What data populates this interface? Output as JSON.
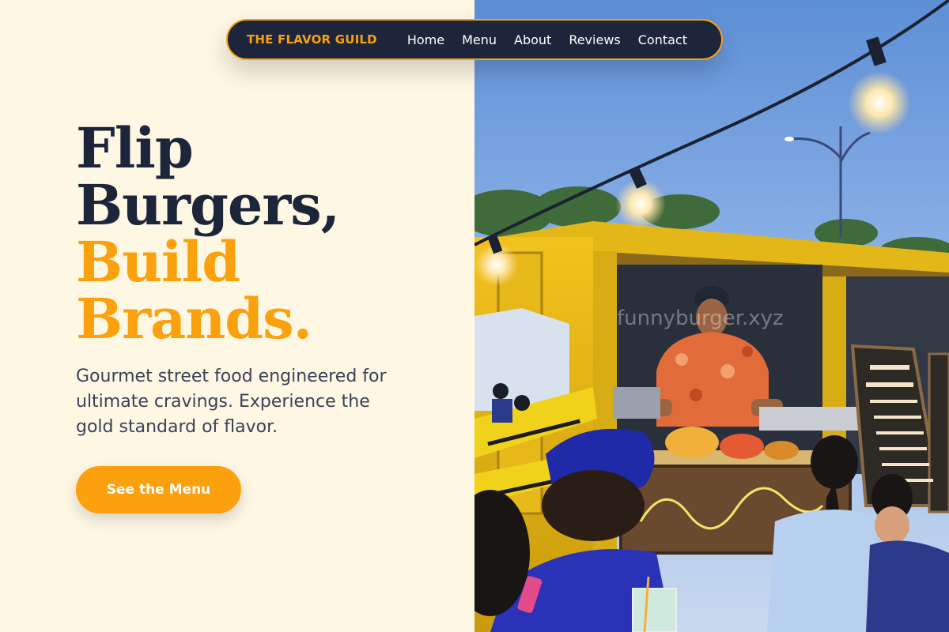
{
  "nav": {
    "brand": "THE FLAVOR GUILD",
    "links": [
      "Home",
      "Menu",
      "About",
      "Reviews",
      "Contact"
    ]
  },
  "hero": {
    "headline_dark": [
      "Flip",
      "Burgers,"
    ],
    "headline_accent": [
      "Build",
      "Brands."
    ],
    "subtext": "Gourmet street food engineered for ultimate cravings. Experience the gold standard of flavor.",
    "cta_label": "See the Menu"
  },
  "image": {
    "watermark": "funnyburger.xyz"
  },
  "colors": {
    "accent": "#fca10e",
    "navy": "#1c2539",
    "cream": "#fef7e4"
  }
}
